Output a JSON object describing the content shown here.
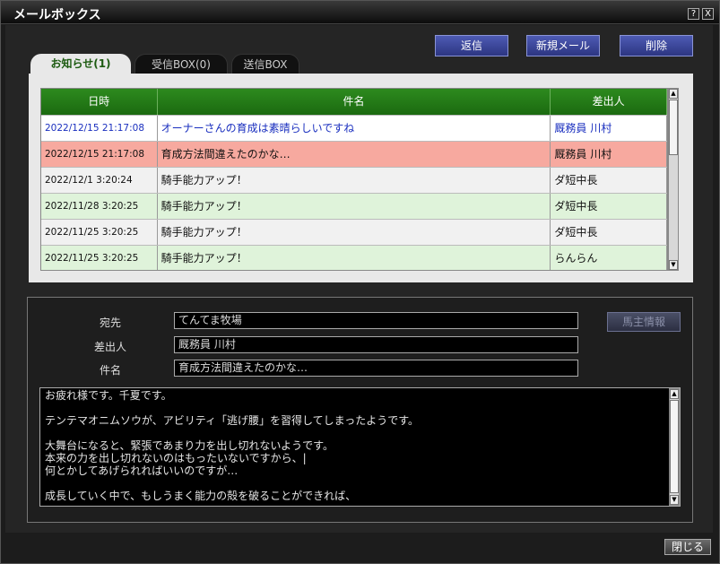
{
  "window": {
    "title": "メールボックス",
    "help_label": "?",
    "close_label": "X"
  },
  "toolbar": {
    "reply": "返信",
    "new_mail": "新規メール",
    "delete": "削除"
  },
  "tabs": [
    {
      "label": "お知らせ(1)",
      "active": true
    },
    {
      "label": "受信BOX(0)",
      "active": false
    },
    {
      "label": "送信BOX",
      "active": false
    }
  ],
  "table": {
    "headers": {
      "date": "日時",
      "subject": "件名",
      "sender": "差出人"
    },
    "rows": [
      {
        "date": "2022/12/15 21:17:08",
        "subject": "オーナーさんの育成は素晴らしいですね",
        "sender": "厩務員 川村"
      },
      {
        "date": "2022/12/15 21:17:08",
        "subject": "育成方法間違えたのかな…",
        "sender": "厩務員 川村"
      },
      {
        "date": "2022/12/1 3:20:24",
        "subject": "騎手能力アップ！",
        "sender": "ダ短中長"
      },
      {
        "date": "2022/11/28 3:20:25",
        "subject": "騎手能力アップ！",
        "sender": "ダ短中長"
      },
      {
        "date": "2022/11/25 3:20:25",
        "subject": "騎手能力アップ！",
        "sender": "ダ短中長"
      },
      {
        "date": "2022/11/25 3:20:25",
        "subject": "騎手能力アップ！",
        "sender": "らんらん"
      }
    ]
  },
  "detail": {
    "to_label": "宛先",
    "to_value": "てんてま牧場",
    "from_label": "差出人",
    "from_value": "厩務員 川村",
    "subject_label": "件名",
    "subject_value": "育成方法間違えたのかな…",
    "owner_info_button": "馬主情報",
    "body": "お疲れ様です。千夏です。\n\nテンテマオニムソウが、アビリティ「逃げ腰」を習得してしまったようです。\n\n大舞台になると、緊張であまり力を出し切れないようです。\n本来の力を出し切れないのはもったいないですから、|\n何とかしてあげられればいいのですが…\n\n成長していく中で、もしうまく能力の殻を破ることができれば、"
  },
  "footer": {
    "close": "閉じる"
  },
  "colors": {
    "header_green": "#1b6a10",
    "selected_row": "#f7a99f",
    "read_row": "#dff3da",
    "unread_text": "#1a2fbf"
  }
}
